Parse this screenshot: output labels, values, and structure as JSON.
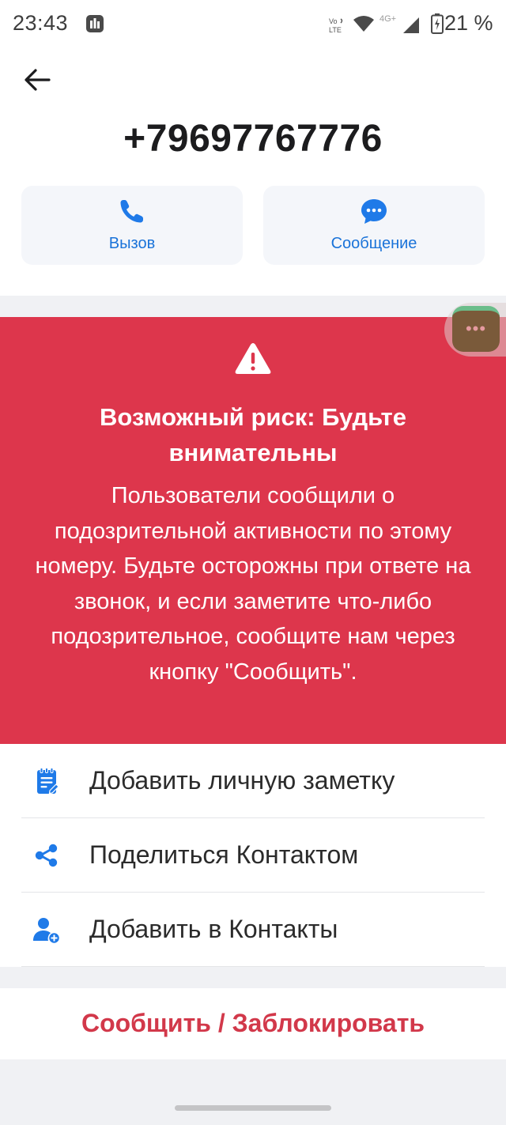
{
  "status_bar": {
    "time": "23:43",
    "volte_text": "Vo LTE",
    "network_type": "4G+",
    "battery_percent": "21 %"
  },
  "contact": {
    "phone_number": "+79697767776"
  },
  "actions": {
    "call_label": "Вызов",
    "message_label": "Сообщение"
  },
  "warning": {
    "title": "Возможный риск: Будьте внимательны",
    "text": "Пользователи сообщили о подозрительной активности по этому номеру. Будьте осторожны при ответе на звонок, и если заметите что-либо подозрительное, сообщите нам через кнопку \"Сообщить\".",
    "bg_color": "#dd364c"
  },
  "list": {
    "items": [
      {
        "label": "Добавить личную заметку",
        "icon": "note-icon"
      },
      {
        "label": "Поделиться Контактом",
        "icon": "share-icon"
      },
      {
        "label": "Добавить в Контакты",
        "icon": "add-contact-icon"
      }
    ]
  },
  "report_button": {
    "label": "Сообщить / Заблокировать",
    "color": "#d2384a"
  },
  "colors": {
    "accent": "#1a73d9",
    "icon_blue": "#1f7ae8"
  }
}
